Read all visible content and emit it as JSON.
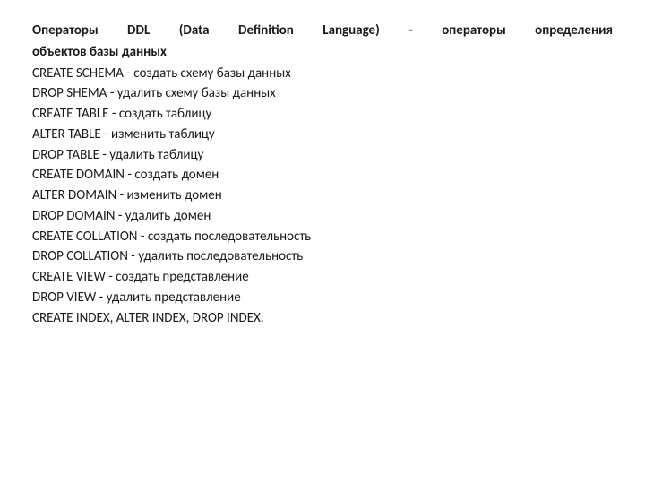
{
  "title_line1": "Операторы DDL (Data Definition Language) - операторы определения",
  "title_line2": "объектов базы данных",
  "lines": [
    "CREATE SCHEMA - создать схему базы данных",
    "DROP SHEMA - удалить схему базы данных",
    "CREATE TABLE - создать таблицу",
    "ALTER TABLE - изменить таблицу",
    "DROP TABLE - удалить таблицу",
    "CREATE DOMAIN - создать домен",
    "ALTER DOMAIN - изменить домен",
    "DROP DOMAIN - удалить домен",
    "CREATE COLLATION - создать последовательность",
    "DROP COLLATION - удалить последовательность",
    "CREATE VIEW - создать представление",
    "DROP VIEW - удалить представление",
    "CREATE INDEX, ALTER INDEX, DROP INDEX."
  ]
}
